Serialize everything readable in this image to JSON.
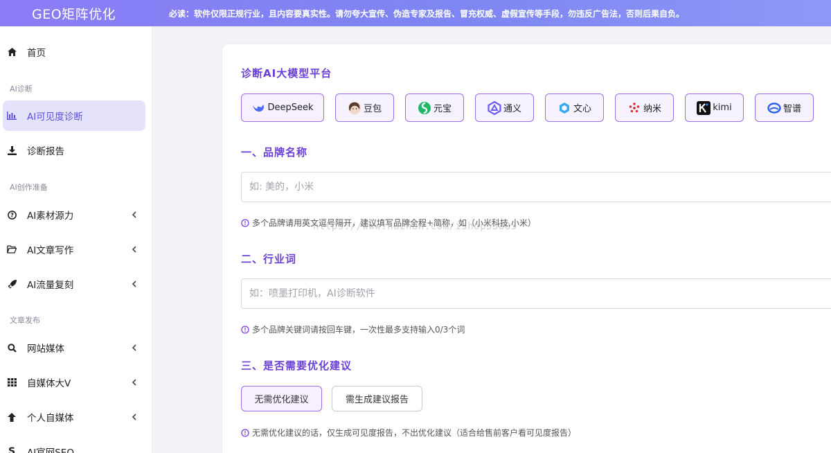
{
  "header": {
    "brand": "GEO矩阵优化",
    "notice": "必读：软件仅限正规行业，且内容要真实性。请勿夸大宣传、伪造专家及报告、冒充权威、虚假宣传等手段，勿违反广告法，否则后果自负。"
  },
  "sidebar": {
    "home": "首页",
    "section_ai_diag": "AI诊断",
    "visibility": "AI可见度诊断",
    "report": "诊断报告",
    "section_ai_prep": "AI创作准备",
    "material": "AI素材源力",
    "writing": "AI文章写作",
    "traffic": "AI流量复刻",
    "section_publish": "文章发布",
    "site_media": "网站媒体",
    "self_media": "自媒体大V",
    "personal_media": "个人自媒体",
    "seo": "AI官网SEO"
  },
  "main": {
    "platform_title": "诊断AI大模型平台",
    "platforms": [
      {
        "label": "DeepSeek",
        "icon": "deepseek-icon"
      },
      {
        "label": "豆包",
        "icon": "doubao-icon"
      },
      {
        "label": "元宝",
        "icon": "yuanbao-icon"
      },
      {
        "label": "通义",
        "icon": "tongyi-icon"
      },
      {
        "label": "文心",
        "icon": "wenxin-icon"
      },
      {
        "label": "纳米",
        "icon": "nami-icon"
      },
      {
        "label": "kimi",
        "icon": "kimi-icon"
      },
      {
        "label": "智谱",
        "icon": "zhipu-icon"
      }
    ],
    "brand_title": "一、品牌名称",
    "brand_placeholder": "如: 美的，小米",
    "brand_hint": "多个品牌请用英文逗号隔开，建议填写品牌全程+简称，如（小米科技,小米）",
    "industry_title": "二、行业词",
    "industry_placeholder": "如：喷墨打印机，AI诊断软件",
    "industry_hint": "多个品牌关键词请按回车键，一次性最多支持输入0/3个词",
    "optimize_title": "三、是否需要优化建议",
    "opt_no": "无需优化建议",
    "opt_yes": "需生成建议报告",
    "optimize_hint": "无需优化建议的话，仅生成可见度报告，不出优化建议（适合给售前客户看可见度报告）",
    "watermark": "https://www.huzhan.com/ishop53885"
  },
  "colors": {
    "accent": "#6a3fd6",
    "active_bg": "#e4e3fb",
    "header_gradient_start": "#8b7cf6",
    "header_gradient_end": "#8d98f6"
  }
}
